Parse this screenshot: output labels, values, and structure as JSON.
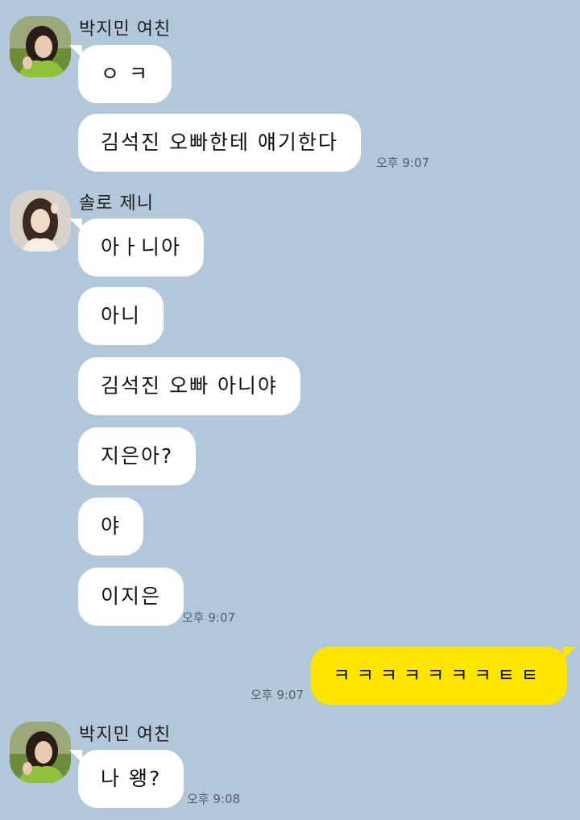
{
  "colors": {
    "background": "#b2c7d9",
    "received_bubble": "#ffffff",
    "sent_bubble": "#fee500"
  },
  "groups": [
    {
      "sender": "박지민 여친",
      "messages": [
        "ㅇ ㅋ",
        "김석진 오빠한테 얘기한다"
      ],
      "time": "오후 9:07"
    },
    {
      "sender": "솔로 제니",
      "messages": [
        "아ㅏ니아",
        "아니",
        "김석진 오빠 아니야",
        "지은아?",
        "야",
        "이지은"
      ],
      "time": "오후 9:07"
    },
    {
      "sender": "me",
      "messages": [
        "ㅋㅋㅋㅋㅋㅋㅋㅌㅌ"
      ],
      "time": "오후 9:07"
    },
    {
      "sender": "박지민 여친",
      "messages": [
        "나 왱?"
      ],
      "time": "오후 9:08"
    }
  ]
}
